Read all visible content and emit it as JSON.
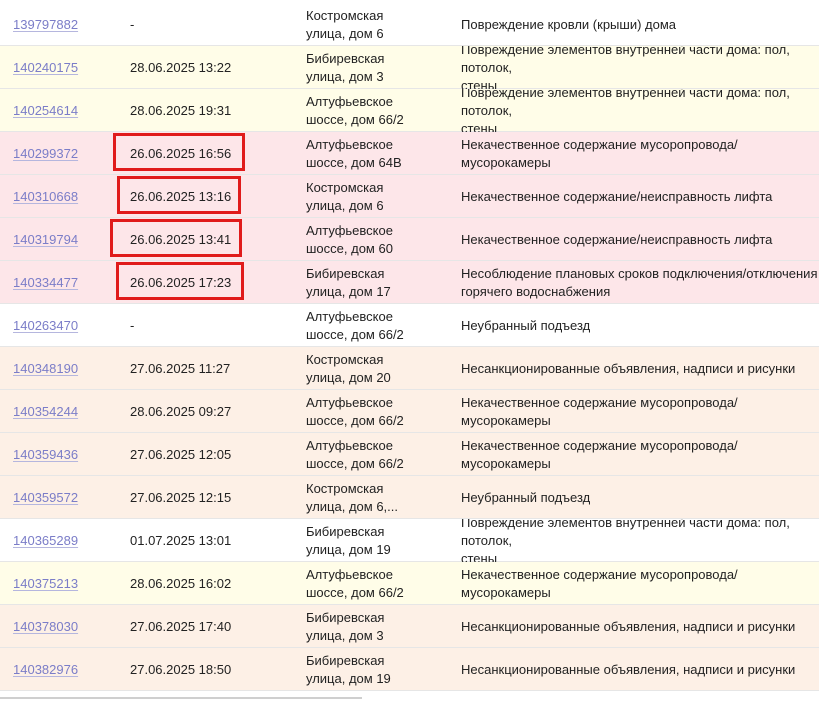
{
  "rows": [
    {
      "id": "139797882",
      "date": "-",
      "address": "Костромская\nулица, дом 6",
      "description": "Повреждение кровли (крыши) дома",
      "bg": "white",
      "highlight": false
    },
    {
      "id": "140240175",
      "date": "28.06.2025 13:22",
      "address": "Бибиревская\nулица, дом 3",
      "description": "Повреждение элементов внутренней части дома: пол, потолок,\nстены",
      "bg": "yellow",
      "highlight": false
    },
    {
      "id": "140254614",
      "date": "28.06.2025 19:31",
      "address": "Алтуфьевское\nшоссе, дом 66/2",
      "description": "Повреждение элементов внутренней части дома: пол, потолок,\nстены",
      "bg": "yellow",
      "highlight": false
    },
    {
      "id": "140299372",
      "date": "26.06.2025 16:56",
      "address": "Алтуфьевское\nшоссе, дом 64В",
      "description": "Некачественное содержание мусоропровода/мусорокамеры",
      "bg": "pink",
      "highlight": true
    },
    {
      "id": "140310668",
      "date": "26.06.2025 13:16",
      "address": "Костромская\nулица, дом 6",
      "description": "Некачественное содержание/неисправность лифта",
      "bg": "pink",
      "highlight": true
    },
    {
      "id": "140319794",
      "date": "26.06.2025 13:41",
      "address": "Алтуфьевское\nшоссе, дом 60",
      "description": "Некачественное содержание/неисправность лифта",
      "bg": "pink",
      "highlight": true
    },
    {
      "id": "140334477",
      "date": "26.06.2025 17:23",
      "address": "Бибиревская\nулица, дом 17",
      "description": "Несоблюдение плановых сроков подключения/отключения\nгорячего водоснабжения",
      "bg": "pink",
      "highlight": true
    },
    {
      "id": "140263470",
      "date": "-",
      "address": "Алтуфьевское\nшоссе, дом 66/2",
      "description": "Неубранный подъезд",
      "bg": "white",
      "highlight": false
    },
    {
      "id": "140348190",
      "date": "27.06.2025 11:27",
      "address": "Костромская\nулица, дом 20",
      "description": "Несанкционированные объявления, надписи и рисунки",
      "bg": "peach",
      "highlight": false
    },
    {
      "id": "140354244",
      "date": "28.06.2025 09:27",
      "address": "Алтуфьевское\nшоссе, дом 66/2",
      "description": "Некачественное содержание мусоропровода/мусорокамеры",
      "bg": "peach",
      "highlight": false
    },
    {
      "id": "140359436",
      "date": "27.06.2025 12:05",
      "address": "Алтуфьевское\nшоссе, дом 66/2",
      "description": "Некачественное содержание мусоропровода/мусорокамеры",
      "bg": "peach",
      "highlight": false
    },
    {
      "id": "140359572",
      "date": "27.06.2025 12:15",
      "address": "Костромская\nулица, дом 6,...",
      "description": "Неубранный подъезд",
      "bg": "peach",
      "highlight": false
    },
    {
      "id": "140365289",
      "date": "01.07.2025 13:01",
      "address": "Бибиревская\nулица, дом 19",
      "description": "Повреждение элементов внутренней части дома: пол, потолок,\nстены",
      "bg": "white",
      "highlight": false
    },
    {
      "id": "140375213",
      "date": "28.06.2025 16:02",
      "address": "Алтуфьевское\nшоссе, дом 66/2",
      "description": "Некачественное содержание мусоропровода/мусорокамеры",
      "bg": "yellow",
      "highlight": false
    },
    {
      "id": "140378030",
      "date": "27.06.2025 17:40",
      "address": "Бибиревская\nулица, дом 3",
      "description": "Несанкционированные объявления, надписи и рисунки",
      "bg": "peach",
      "highlight": false
    },
    {
      "id": "140382976",
      "date": "27.06.2025 18:50",
      "address": "Бибиревская\nулица, дом 19",
      "description": "Несанкционированные объявления, надписи и рисунки",
      "bg": "peach",
      "highlight": false
    }
  ],
  "colors": {
    "link": "#7b7dc8",
    "highlight_border": "#e01b1b",
    "bg_white": "#ffffff",
    "bg_yellow": "#fffde8",
    "bg_pink": "#fde6e9",
    "bg_peach": "#fdf0e6"
  }
}
